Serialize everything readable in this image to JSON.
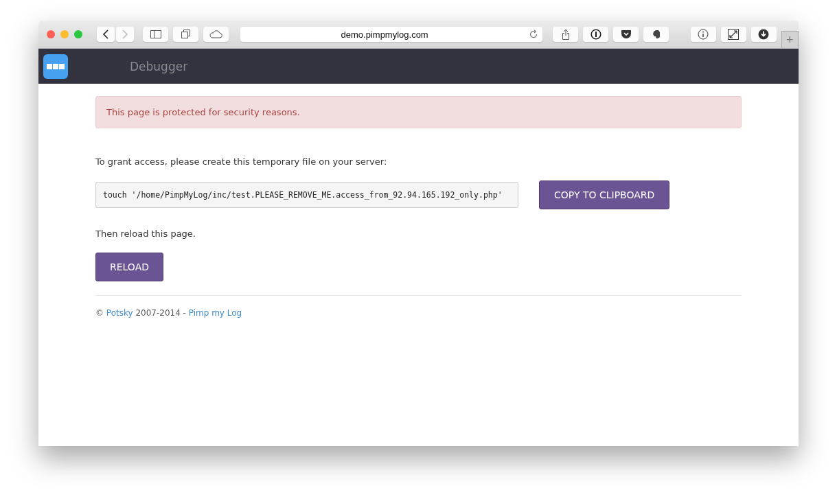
{
  "browser": {
    "url": "demo.pimpmylog.com",
    "nav_buttons": [
      {
        "kind": "back",
        "disabled": false
      },
      {
        "kind": "forward",
        "disabled": true
      }
    ],
    "new_tab": "+"
  },
  "header": {
    "title": "Debugger"
  },
  "alert": "This page is protected for security reasons.",
  "instruction": "To grant access, please create this temporary file on your server:",
  "command": "touch '/home/PimpMyLog/inc/test.PLEASE_REMOVE_ME.access_from_92.94.165.192_only.php'",
  "copy_button": "COPY TO CLIPBOARD",
  "reload_text": "Then reload this page.",
  "reload_button": "RELOAD",
  "footer": {
    "prefix": "©",
    "author_link": "Potsky",
    "years": "2007-2014 -",
    "site_link": "Pimp my Log"
  }
}
